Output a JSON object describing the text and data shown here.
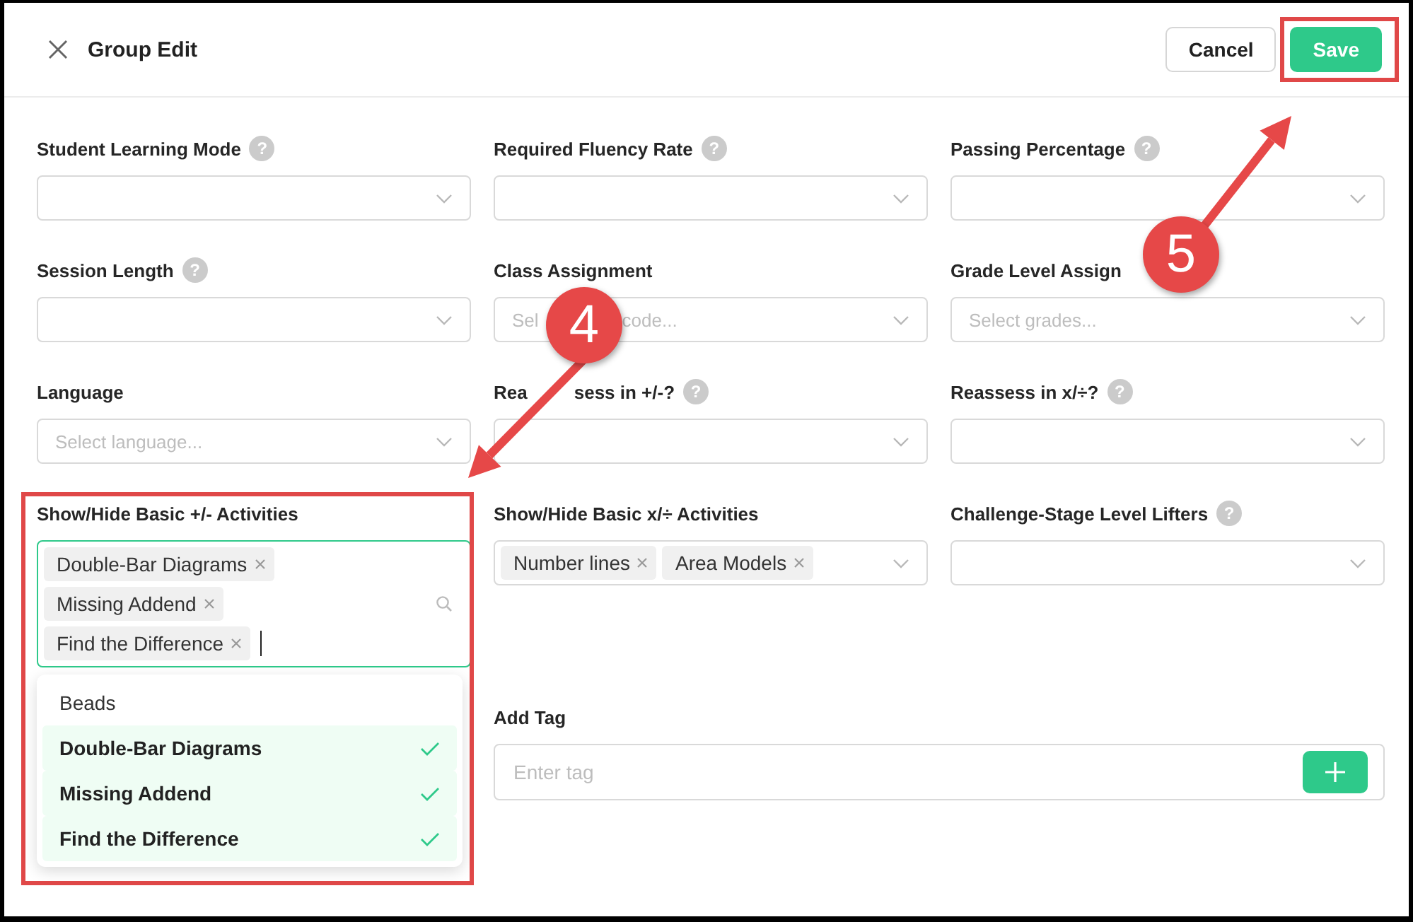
{
  "window": {
    "title": "Group Edit"
  },
  "header_buttons": [
    {
      "label": "Cancel",
      "kind": "secondary",
      "highlighted": false
    },
    {
      "label": "Save",
      "kind": "primary",
      "highlighted": true
    }
  ],
  "fields": [
    {
      "label": "Student Learning Mode",
      "help": "?",
      "kind": "select"
    },
    {
      "label": "Required Fluency Rate",
      "help": "?",
      "kind": "select"
    },
    {
      "label": "Passing Percentage",
      "help": "?",
      "kind": "select"
    },
    {
      "label": "Session Length",
      "help": "?",
      "kind": "select"
    },
    {
      "label": "Class Assignment",
      "kind": "select",
      "placeholder_parts": [
        "Sel",
        "code..."
      ]
    },
    {
      "label": "Grade Level Assign",
      "kind": "select",
      "placeholder": "Select grades..."
    },
    {
      "label": "Language",
      "kind": "select",
      "placeholder": "Select language..."
    },
    {
      "label_parts": [
        "Rea",
        "sess in +/-?"
      ],
      "help": "?",
      "kind": "select"
    },
    {
      "label": "Reassess in x/÷?",
      "help": "?",
      "kind": "select"
    },
    {
      "label": "Show/Hide Basic +/- Activities",
      "kind": "multiselect",
      "focused": true,
      "open": true,
      "highlighted": true,
      "tags": [
        "Double-Bar Diagrams",
        "Missing Addend",
        "Find the Difference"
      ],
      "options": [
        {
          "label": "Beads",
          "selected": false
        },
        {
          "label": "Double-Bar Diagrams",
          "selected": true
        },
        {
          "label": "Missing Addend",
          "selected": true
        },
        {
          "label": "Find the Difference",
          "selected": true
        }
      ]
    },
    {
      "label": "Show/Hide Basic x/÷ Activities",
      "kind": "multiselect",
      "focused": false,
      "open": false,
      "highlighted": false,
      "tags": [
        "Number lines",
        "Area Models"
      ]
    },
    {
      "label": "Challenge-Stage Level Lifters",
      "help": "?",
      "kind": "select"
    },
    {
      "label": "Add Tag",
      "kind": "tag-input",
      "placeholder": "Enter tag"
    }
  ],
  "annotations": [
    {
      "number": "4"
    },
    {
      "number": "5"
    }
  ]
}
